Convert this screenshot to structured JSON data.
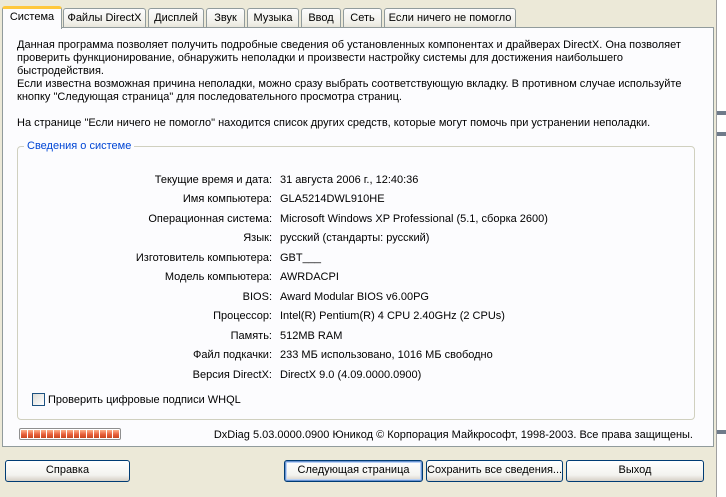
{
  "tabs": [
    {
      "label": "Система",
      "active": true
    },
    {
      "label": "Файлы DirectX"
    },
    {
      "label": "Дисплей"
    },
    {
      "label": "Звук"
    },
    {
      "label": "Музыка"
    },
    {
      "label": "Ввод"
    },
    {
      "label": "Сеть"
    },
    {
      "label": "Если ничего не помогло"
    }
  ],
  "intro": {
    "p1": "Данная программа позволяет получить подробные сведения об установленных компонентах и драйверах DirectX. Она позволяет проверить функционирование, обнаружить неполадки и произвести настройку системы для достижения наибольшего быстродействия.",
    "p2": "Если известна возможная причина неполадки, можно сразу выбрать соответствующую вкладку. В противном случае используйте кнопку \"Следующая страница\" для последовательного просмотра страниц.",
    "p3": "На странице \"Если ничего не помогло\" находится список других средств, которые могут помочь при устранении неполадки."
  },
  "sysinfo": {
    "title": "Сведения о системе",
    "rows": [
      {
        "label": "Текущие время и дата:",
        "value": "31 августа 2006 г., 12:40:36"
      },
      {
        "label": "Имя компьютера:",
        "value": "GLA5214DWL910HE"
      },
      {
        "label": "Операционная система:",
        "value": "Microsoft Windows XP Professional (5.1, сборка 2600)"
      },
      {
        "label": "Язык:",
        "value": "русский (стандарты: русский)"
      },
      {
        "label": "Изготовитель компьютера:",
        "value": "GBT___"
      },
      {
        "label": "Модель компьютера:",
        "value": "AWRDACPI"
      },
      {
        "label": "BIOS:",
        "value": "Award Modular BIOS v6.00PG"
      },
      {
        "label": "Процессор:",
        "value": "Intel(R) Pentium(R) 4 CPU 2.40GHz (2 CPUs)"
      },
      {
        "label": "Память:",
        "value": "512MB RAM"
      },
      {
        "label": "Файл подкачки:",
        "value": "233 МБ использовано, 1016 МБ свободно"
      },
      {
        "label": "Версия DirectX:",
        "value": "DirectX 9.0 (4.09.0000.0900)"
      }
    ],
    "whql_label": "Проверить цифровые подписи WHQL",
    "whql_checked": false
  },
  "progress": {
    "percent": 100
  },
  "copyright": "DxDiag 5.03.0000.0900 Юникод  © Корпорация Майкрософт, 1998-2003.  Все права защищены.",
  "buttons": {
    "help": "Справка",
    "next": "Следующая страница",
    "save_all": "Сохранить все сведения...",
    "exit": "Выход"
  },
  "colors": {
    "accent": "#0046d5",
    "progress": "#e8603c",
    "tab_highlight": "#ffc83c"
  }
}
